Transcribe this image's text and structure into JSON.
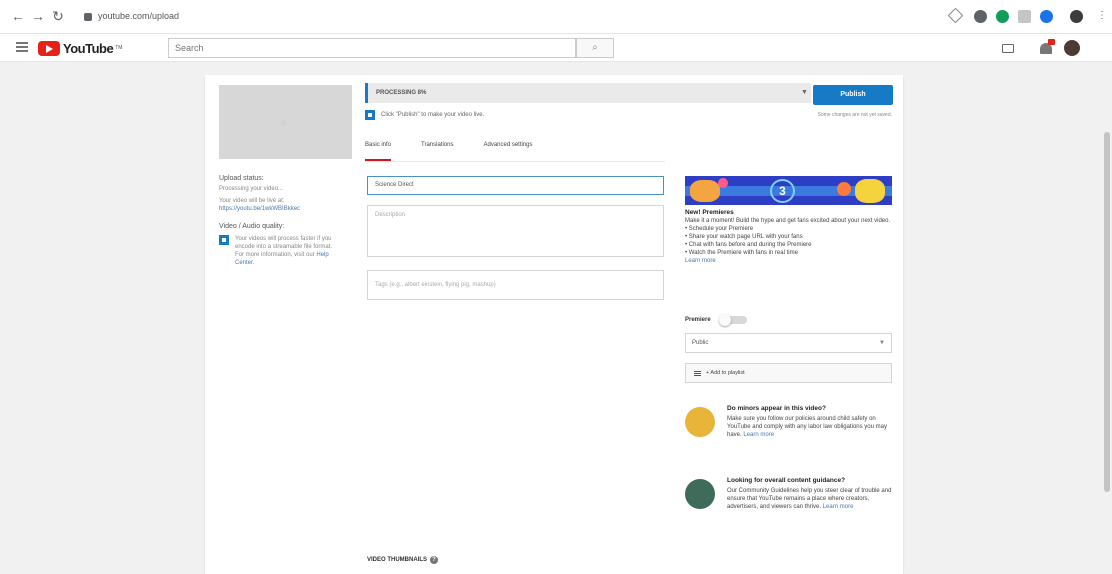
{
  "browser": {
    "url": "youtube.com/upload",
    "colors": {
      "toolbar_bg": "#ffffff"
    }
  },
  "header": {
    "logo_text": "YouTube",
    "logo_tm": "TM",
    "search_placeholder": "Search",
    "colors": {
      "logo_red": "#e62117"
    }
  },
  "upload": {
    "progress_text": "PROCESSING 8%",
    "publish_label": "Publish",
    "publish_hint": "Click \"Publish\" to make your video live.",
    "unsaved_text": "Some changes are not yet saved.",
    "tabs": [
      {
        "label": "Basic info",
        "active": true
      },
      {
        "label": "Translations",
        "active": false
      },
      {
        "label": "Advanced settings",
        "active": false
      }
    ],
    "title_value": "Science Direct",
    "description_placeholder": "Description",
    "tags_placeholder": "Tags (e.g., albert einstein, flying pig, mashup)",
    "thumbnails_label": "VIDEO THUMBNAILS",
    "colors": {
      "accent": "#167ac6",
      "tab_active": "#cc181e"
    }
  },
  "left_info": {
    "upload_status_heading": "Upload status:",
    "upload_status_text": "Processing your video...",
    "video_live_text": "Your video will be live at:",
    "video_link": "https://youtu.be/1wkWBIBkkec",
    "quality_heading": "Video / Audio quality:",
    "quality_text": "Your videos will process faster if you encode into a streamable file format. For more information, visit our",
    "quality_link": "Help Center."
  },
  "premiere_promo": {
    "badge_number": "3",
    "heading": "New! Premieres",
    "intro": "Make it a moment! Build the hype and get fans excited about your next video.",
    "bullets": [
      "• Schedule your Premiere",
      "• Share your watch page URL with your fans",
      "• Chat with fans before and during the Premiere",
      "• Watch the Premiere with fans in real time"
    ],
    "learn_more": "Learn more",
    "premiere_label": "Premiere",
    "privacy_value": "Public",
    "playlist_label": "+ Add to playlist"
  },
  "info_cards": [
    {
      "heading": "Do minors appear in this video?",
      "text": "Make sure you follow our policies around child safety on YouTube and comply with any labor law obligations you may have.",
      "link": "Learn more",
      "icon_color": "#e8b43a"
    },
    {
      "heading": "Looking for overall content guidance?",
      "text": "Our Community Guidelines help you steer clear of trouble and ensure that YouTube remains a place where creators, advertisers, and viewers can thrive.",
      "link": "Learn more",
      "icon_color": "#3f6b5a"
    }
  ]
}
